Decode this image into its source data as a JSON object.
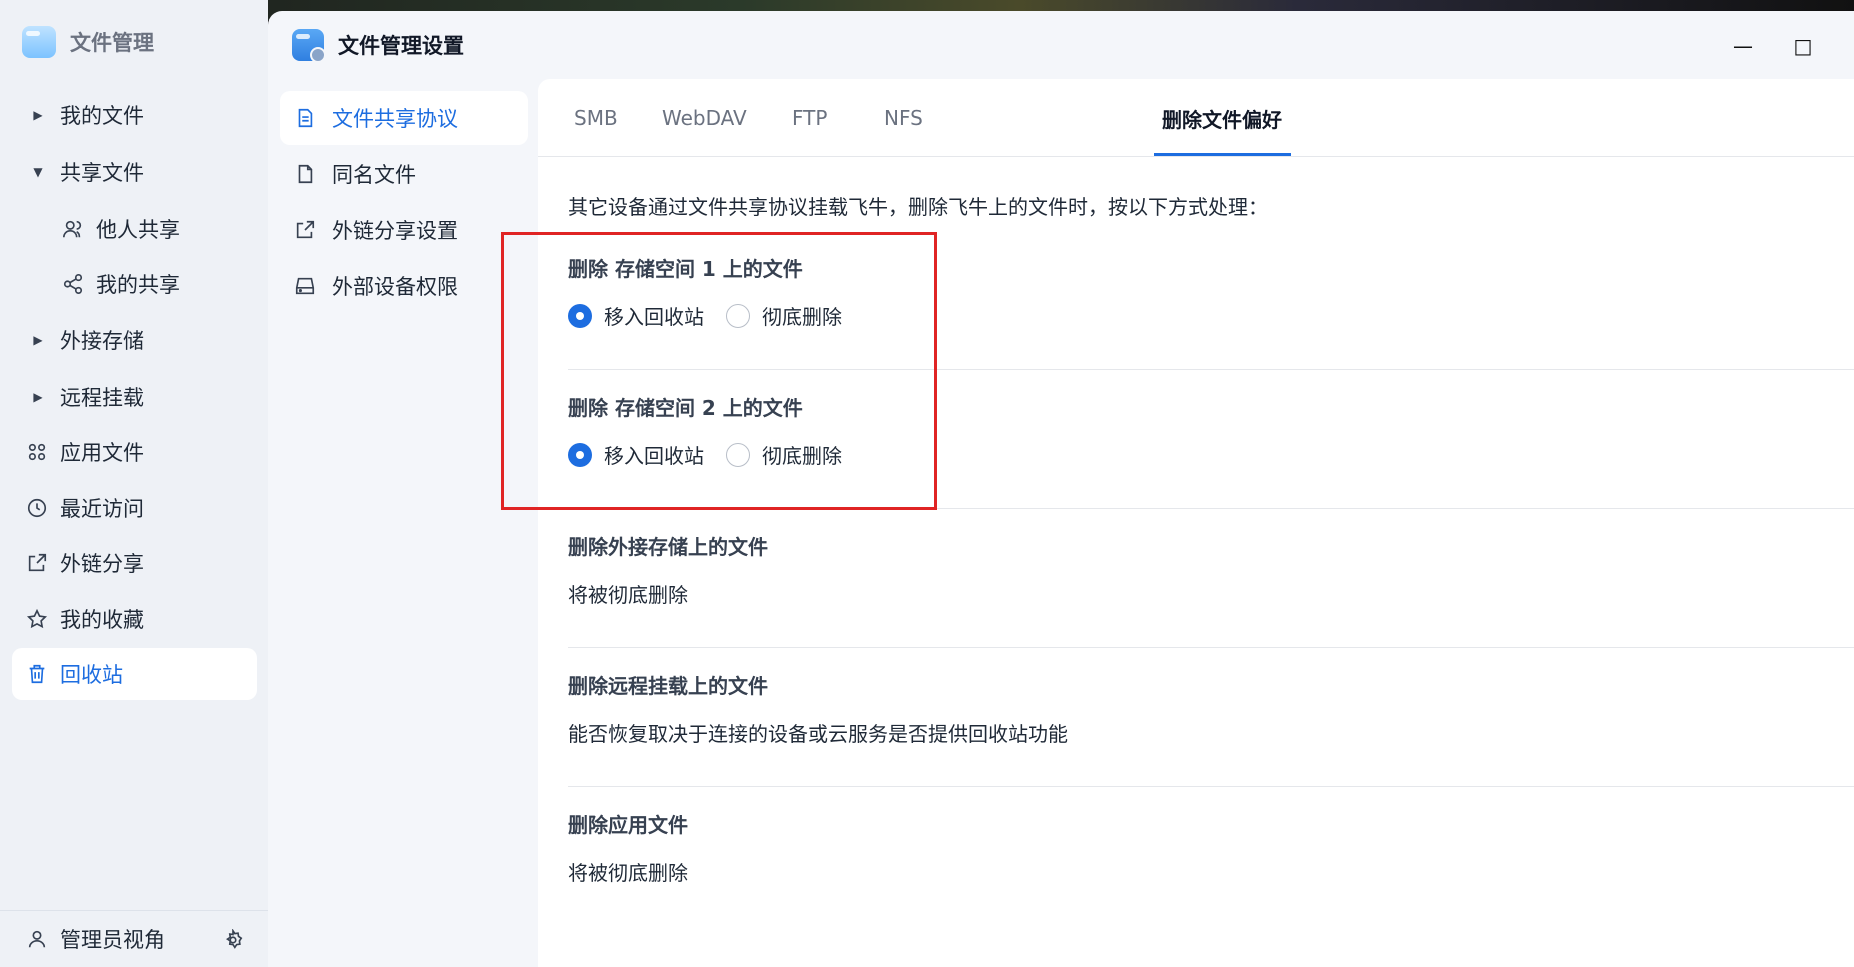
{
  "app": {
    "title": "文件管理"
  },
  "sidebar": {
    "items": [
      {
        "label": "我的文件",
        "icon": "caret-right-icon"
      },
      {
        "label": "共享文件",
        "icon": "caret-down-icon"
      },
      {
        "label": "他人共享",
        "icon": "users-icon"
      },
      {
        "label": "我的共享",
        "icon": "share-icon"
      },
      {
        "label": "外接存储",
        "icon": "caret-right-icon"
      },
      {
        "label": "远程挂载",
        "icon": "caret-right-icon"
      },
      {
        "label": "应用文件",
        "icon": "apps-icon"
      },
      {
        "label": "最近访问",
        "icon": "clock-icon"
      },
      {
        "label": "外链分享",
        "icon": "external-link-icon"
      },
      {
        "label": "我的收藏",
        "icon": "star-icon"
      },
      {
        "label": "回收站",
        "icon": "trash-icon",
        "active": true
      }
    ],
    "bottom": {
      "label": "管理员视角"
    }
  },
  "window": {
    "title": "文件管理设置",
    "controls": {
      "minimize": "—",
      "maximize": "□"
    }
  },
  "settings_nav": {
    "items": [
      {
        "label": "文件共享协议",
        "active": true
      },
      {
        "label": "同名文件"
      },
      {
        "label": "外链分享设置"
      },
      {
        "label": "外部设备权限"
      }
    ]
  },
  "tabs": [
    {
      "label": "SMB"
    },
    {
      "label": "WebDAV"
    },
    {
      "label": "FTP"
    },
    {
      "label": "NFS"
    },
    {
      "label": "删除文件偏好",
      "active": true
    }
  ],
  "content": {
    "description": "其它设备通过文件共享协议挂载飞牛，删除飞牛上的文件时，按以下方式处理：",
    "storage1": {
      "title": "删除 存储空间 1 上的文件",
      "options": [
        "移入回收站",
        "彻底删除"
      ],
      "selected": "移入回收站"
    },
    "storage2": {
      "title": "删除 存储空间 2 上的文件",
      "options": [
        "移入回收站",
        "彻底删除"
      ],
      "selected": "移入回收站"
    },
    "external": {
      "title": "删除外接存储上的文件",
      "text": "将被彻底删除"
    },
    "remote": {
      "title": "删除远程挂载上的文件",
      "text": "能否恢复取决于连接的设备或云服务是否提供回收站功能"
    },
    "apps": {
      "title": "删除应用文件",
      "text": "将被彻底删除"
    }
  },
  "colors": {
    "accent": "#1d6de0",
    "highlight": "#e02424"
  }
}
